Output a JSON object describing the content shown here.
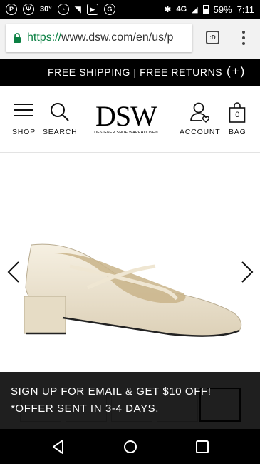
{
  "status_bar": {
    "temperature": "30°",
    "network": "4G",
    "battery": "59%",
    "time": "7:11"
  },
  "browser": {
    "url_scheme": "https://",
    "url_rest": "www.dsw.com/en/us/p",
    "tabs_label": ":D"
  },
  "promo": {
    "text": "FREE SHIPPING | FREE RETURNS",
    "toggle": "(+)"
  },
  "header": {
    "shop_label": "SHOP",
    "search_label": "SEARCH",
    "logo_text": "DSW",
    "logo_tagline": "DESIGNER SHOE WAREHOUSE®",
    "account_label": "ACCOUNT",
    "bag_label": "BAG",
    "bag_count": "0"
  },
  "signup_banner": {
    "line1": "SIGN UP FOR EMAIL & GET $10 OFF!",
    "line2": "*OFFER SENT IN 3-4 DAYS."
  },
  "colors": {
    "url_green": "#0b8043",
    "shoe_ivory": "#ece3cf",
    "bar_black": "#000000"
  }
}
